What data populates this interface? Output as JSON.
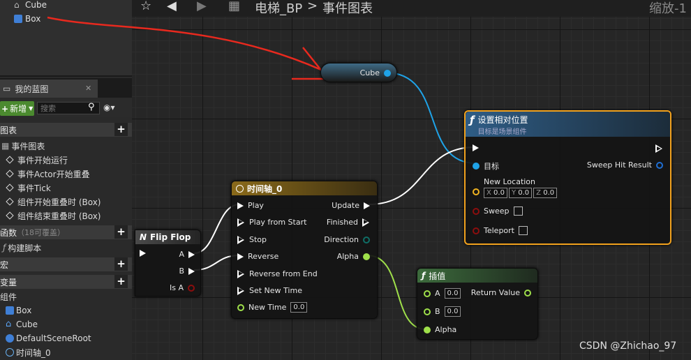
{
  "outliner": {
    "items": [
      {
        "label": "Cube"
      },
      {
        "label": "Box"
      }
    ]
  },
  "my_blueprint": {
    "tab_label": "我的蓝图",
    "add_label": "新增",
    "search_placeholder": "搜索",
    "graphs_header": "图表",
    "event_graph": "事件图表",
    "events": [
      "事件开始运行",
      "事件Actor开始重叠",
      "事件Tick",
      "组件开始重叠时 (Box)",
      "组件结束重叠时 (Box)"
    ],
    "functions_header": "函数",
    "functions_note": "（18可覆盖）",
    "construction_script": "构建脚本",
    "macros_header": "宏",
    "variables_header": "变量",
    "components_header": "组件",
    "components": [
      "Box",
      "Cube",
      "DefaultSceneRoot",
      "时间轴_0"
    ]
  },
  "topbar": {
    "breadcrumb_blueprint": "电梯_BP",
    "breadcrumb_separator": ">",
    "breadcrumb_graph": "事件图表",
    "zoom_label": "缩放-1"
  },
  "nodes": {
    "cube_var": {
      "label": "Cube"
    },
    "set_location": {
      "title": "设置相对位置",
      "subtitle": "目标是场景组件",
      "target": "目标",
      "sweep_hit": "Sweep Hit Result",
      "new_location": "New Location",
      "x_label": "X",
      "x": "0.0",
      "y_label": "Y",
      "y": "0.0",
      "z_label": "Z",
      "z": "0.0",
      "sweep": "Sweep",
      "teleport": "Teleport"
    },
    "timeline": {
      "title": "时间轴_0",
      "play": "Play",
      "play_from_start": "Play from Start",
      "stop": "Stop",
      "reverse": "Reverse",
      "reverse_from_end": "Reverse from End",
      "set_new_time": "Set New Time",
      "new_time": "New Time",
      "new_time_value": "0.0",
      "update": "Update",
      "finished": "Finished",
      "direction": "Direction",
      "alpha": "Alpha"
    },
    "flipflop": {
      "title": "Flip Flop",
      "a": "A",
      "b": "B",
      "is_a": "Is A"
    },
    "lerp": {
      "title": "插值",
      "a": "A",
      "a_value": "0.0",
      "b": "B",
      "b_value": "0.0",
      "alpha": "Alpha",
      "return_value": "Return Value"
    }
  },
  "watermark": "CSDN @Zhichao_97",
  "colors": {
    "exec": "#ffffff",
    "object_pin": "#1fa3e8",
    "struct_pin": "#f0b320",
    "bool_pin": "#8c0e0e",
    "float_pin": "#9fe04a",
    "selected_outline": "#f1a11d",
    "annotation": "#e8291e"
  }
}
